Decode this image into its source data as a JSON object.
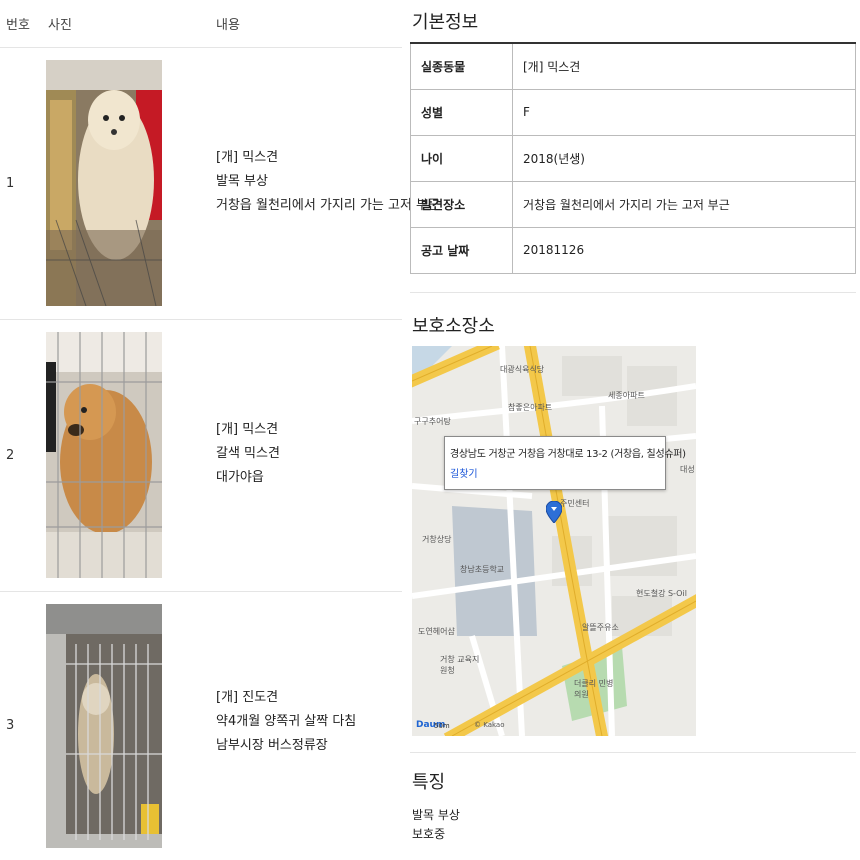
{
  "list": {
    "headers": {
      "number": "번호",
      "photo": "사진",
      "content": "내용"
    },
    "rows": [
      {
        "number": "1",
        "lines": [
          "[개] 믹스견",
          "발목 부상",
          "거창읍 월천리에서 가지리 가는 고저 부근"
        ]
      },
      {
        "number": "2",
        "lines": [
          "[개] 믹스견",
          "갈색 믹스견",
          "대가야읍"
        ]
      },
      {
        "number": "3",
        "lines": [
          "[개] 진도견",
          "약4개월 양쪽귀 살짝 다침",
          "남부시장 버스정류장"
        ]
      }
    ]
  },
  "detail": {
    "basic_title": "기본정보",
    "basic_rows": [
      {
        "key": "실종동물",
        "value": "[개] 믹스견"
      },
      {
        "key": "성별",
        "value": "F"
      },
      {
        "key": "나이",
        "value": "2018(년생)"
      },
      {
        "key": "발견장소",
        "value": "거창읍 월천리에서 가지리 가는 고저 부근"
      },
      {
        "key": "공고 날짜",
        "value": "20181126"
      }
    ],
    "shelter_title": "보호소장소",
    "map": {
      "popup_address": "경상남도 거창군 거창읍 거창대로 13-2 (거창읍, 칠성슈퍼)",
      "route_link": "길찾기",
      "labels": [
        "대광식육식당",
        "참좋은아파트",
        "세종아파트",
        "구구추어탕",
        "주민센터",
        "대성",
        "거창상당",
        "창남초등학교",
        "알뜰주유소",
        "현도철강 S-Oil",
        "도연헤어샵",
        "거창 교육지원청",
        "더클리 민병의원"
      ],
      "scale": "50m",
      "brand": "© Kakao",
      "logo": "Daum"
    },
    "feature_title": "특징",
    "feature_lines": [
      "발목 부상",
      "보호중"
    ]
  },
  "colors": {
    "road_yellow": "#f3c84a",
    "road_white": "#ffffff",
    "map_bg": "#ecebe7",
    "link_blue": "#1a55d8",
    "pin_blue": "#2d6fd6"
  }
}
